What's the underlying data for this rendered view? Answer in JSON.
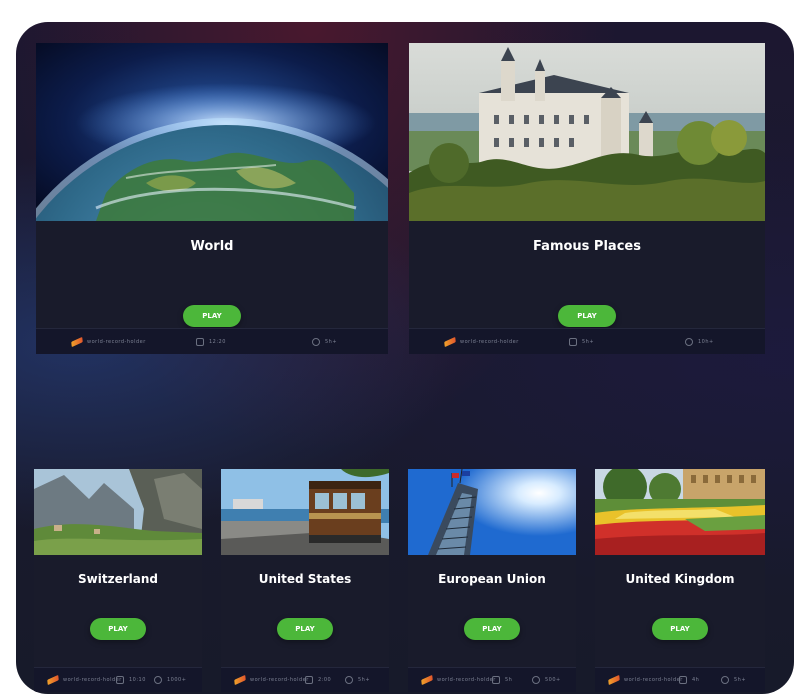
{
  "cards": [
    {
      "id": "world",
      "title": "World",
      "play_label": "PLAY",
      "thumbnail_icon": "earth-from-space-image",
      "stats": [
        "world-record-holder",
        "12:20",
        "5h+"
      ]
    },
    {
      "id": "famous-places",
      "title": "Famous Places",
      "play_label": "PLAY",
      "thumbnail_icon": "castle-image",
      "stats": [
        "world-record-holder",
        "5h+",
        "10h+"
      ]
    },
    {
      "id": "switzerland",
      "title": "Switzerland",
      "play_label": "PLAY",
      "thumbnail_icon": "swiss-valley-image",
      "stats": [
        "world-record-holder",
        "10:10",
        "1000+"
      ]
    },
    {
      "id": "united-states",
      "title": "United States",
      "play_label": "PLAY",
      "thumbnail_icon": "cable-car-image",
      "stats": [
        "world-record-holder",
        "2:00",
        "5h+"
      ]
    },
    {
      "id": "european-union",
      "title": "European Union",
      "play_label": "PLAY",
      "thumbnail_icon": "eu-building-image",
      "stats": [
        "world-record-holder",
        "5h",
        "500+"
      ]
    },
    {
      "id": "united-kingdom",
      "title": "United Kingdom",
      "play_label": "PLAY",
      "thumbnail_icon": "uk-garden-image",
      "stats": [
        "world-record-holder",
        "4h",
        "5h+"
      ]
    }
  ],
  "colors": {
    "play_button": "#4cb73a",
    "card_background": "#191b2b",
    "stats_bar": "#14162a",
    "trophy_icon": "#f0a22a"
  }
}
